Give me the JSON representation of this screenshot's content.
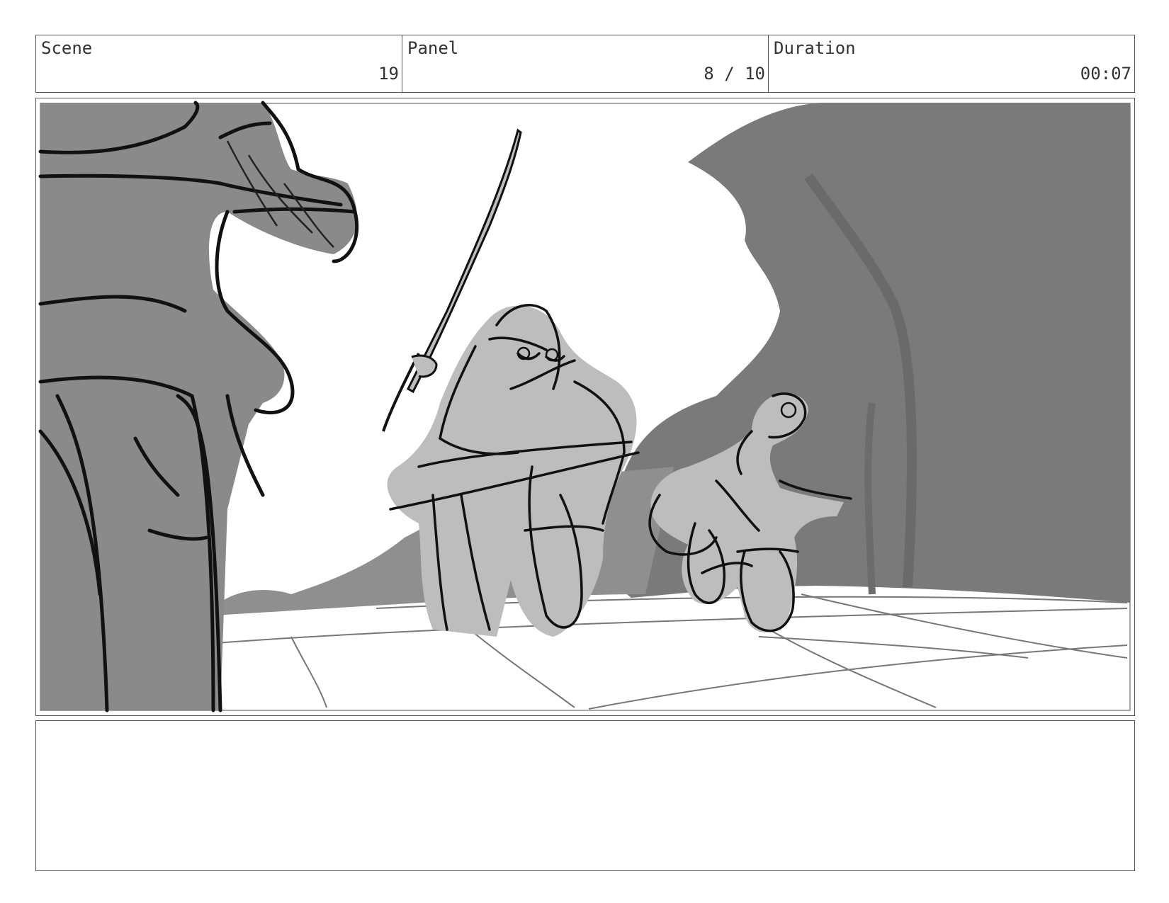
{
  "header": {
    "scene": {
      "label": "Scene",
      "value": "19"
    },
    "panel": {
      "label": "Panel",
      "value": "8 / 10"
    },
    "duration": {
      "label": "Duration",
      "value": "00:07"
    }
  },
  "panel_image": {
    "icon": "storyboard-sketch",
    "colors": {
      "background": "#ffffff",
      "dark_gray": "#7a7a7a",
      "mid_gray": "#8f8f8f",
      "light_gray": "#bdbdbd",
      "line": "#111111"
    }
  },
  "notes": {
    "text": ""
  }
}
